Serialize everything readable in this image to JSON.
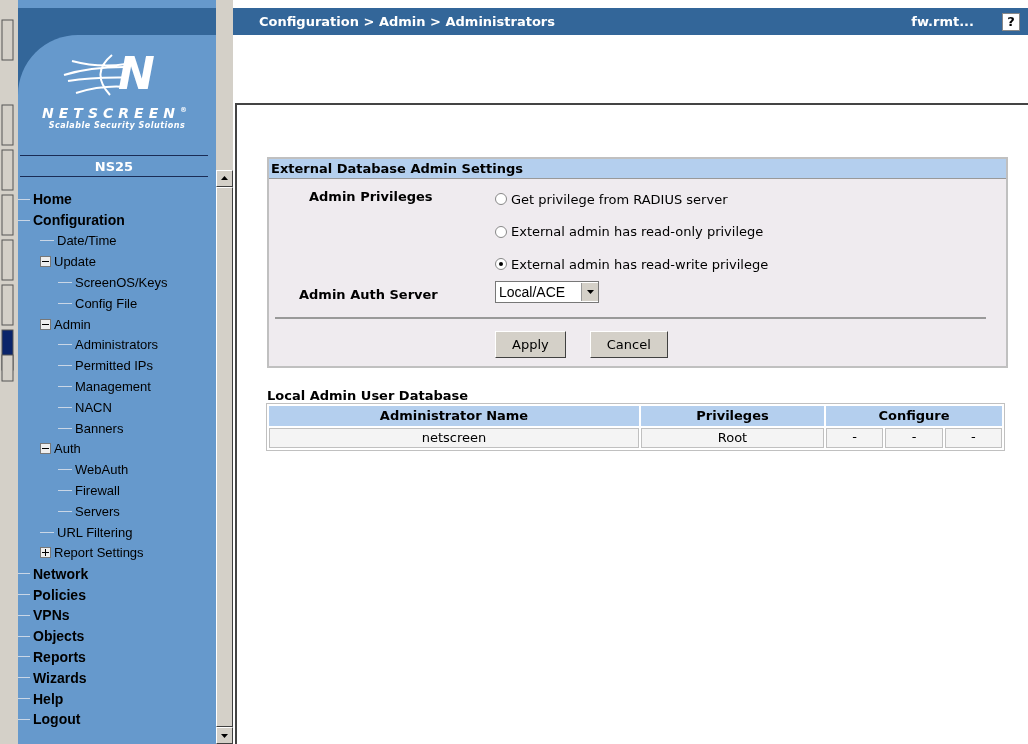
{
  "logo": {
    "mark": "N",
    "brand": "NETSCREEN$^{®}$",
    "tagline": "Scalable Security Solutions",
    "model": "NS25"
  },
  "nav": [
    {
      "label": "Home"
    },
    {
      "label": "Configuration",
      "children": [
        {
          "label": "Date/Time"
        },
        {
          "label": "Update",
          "expanded": true,
          "children": [
            {
              "label": "ScreenOS/Keys"
            },
            {
              "label": "Config File"
            }
          ]
        },
        {
          "label": "Admin",
          "expanded": true,
          "children": [
            {
              "label": "Administrators"
            },
            {
              "label": "Permitted IPs"
            },
            {
              "label": "Management"
            },
            {
              "label": "NACN"
            },
            {
              "label": "Banners"
            }
          ]
        },
        {
          "label": "Auth",
          "expanded": true,
          "children": [
            {
              "label": "WebAuth"
            },
            {
              "label": "Firewall"
            },
            {
              "label": "Servers"
            }
          ]
        },
        {
          "label": "URL Filtering"
        },
        {
          "label": "Report Settings",
          "expanded": false
        }
      ]
    },
    {
      "label": "Network"
    },
    {
      "label": "Policies"
    },
    {
      "label": "VPNs"
    },
    {
      "label": "Objects"
    },
    {
      "label": "Reports"
    },
    {
      "label": "Wizards"
    },
    {
      "label": "Help"
    },
    {
      "label": "Logout"
    }
  ],
  "topbar": {
    "breadcrumb": "Configuration > Admin > Administrators",
    "host": "fw.rmt...",
    "help": "?"
  },
  "settings": {
    "title": "External Database Admin Settings",
    "privileges_label": "Admin Privileges",
    "options": [
      {
        "label": "Get privilege from RADIUS server",
        "selected": false
      },
      {
        "label": "External admin has read-only privilege",
        "selected": false
      },
      {
        "label": "External admin has read-write privilege",
        "selected": true
      }
    ],
    "server_label": "Admin Auth Server",
    "server_value": "Local/ACE",
    "buttons": [
      "Apply",
      "Cancel"
    ]
  },
  "users": {
    "title": "Local Admin User Database",
    "columns": [
      "Administrator Name",
      "Privileges",
      "Configure"
    ],
    "rows": [
      {
        "name": "netscreen",
        "privileges": "Root",
        "configure": [
          "-",
          "-",
          "-"
        ]
      }
    ]
  }
}
